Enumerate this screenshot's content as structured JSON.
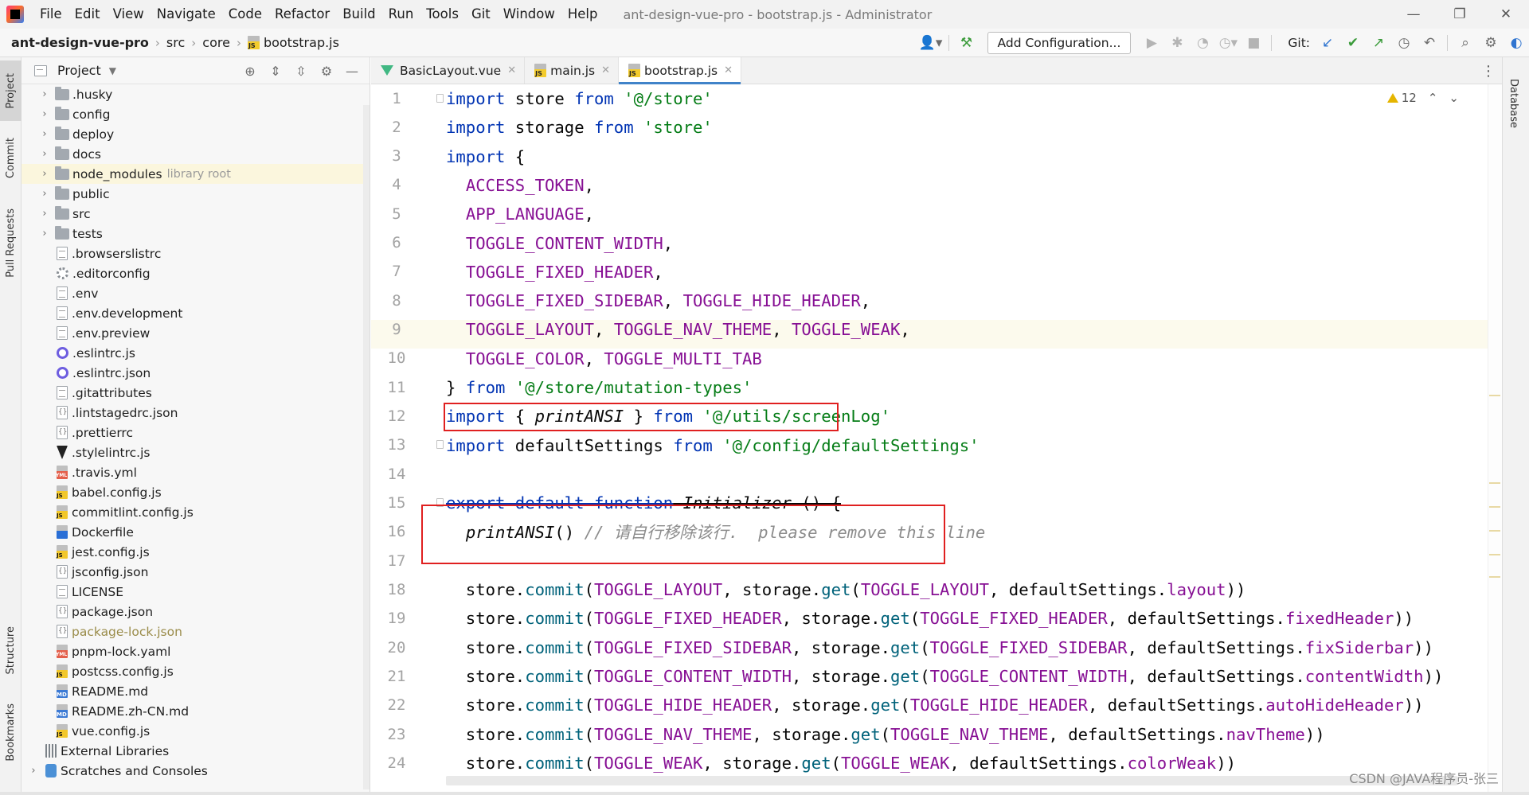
{
  "window": {
    "title": "ant-design-vue-pro - bootstrap.js - Administrator",
    "controls": [
      "—",
      "❐",
      "✕"
    ]
  },
  "menu": [
    "File",
    "Edit",
    "View",
    "Navigate",
    "Code",
    "Refactor",
    "Build",
    "Run",
    "Tools",
    "Git",
    "Window",
    "Help"
  ],
  "breadcrumb": {
    "project": "ant-design-vue-pro",
    "folder1": "src",
    "folder2": "core",
    "file": "bootstrap.js"
  },
  "toolbar": {
    "add_configuration": "Add Configuration...",
    "git_label": "Git:"
  },
  "left_strip": {
    "project": "Project",
    "commit": "Commit",
    "pull_requests": "Pull Requests",
    "structure": "Structure",
    "bookmarks": "Bookmarks"
  },
  "right_strip": {
    "database": "Database"
  },
  "project_panel": {
    "title": "Project",
    "items": [
      {
        "name": ".husky",
        "type": "folder"
      },
      {
        "name": "config",
        "type": "folder"
      },
      {
        "name": "deploy",
        "type": "folder"
      },
      {
        "name": "docs",
        "type": "folder"
      },
      {
        "name": "node_modules",
        "type": "folder",
        "note": "library root"
      },
      {
        "name": "public",
        "type": "folder"
      },
      {
        "name": "src",
        "type": "folder"
      },
      {
        "name": "tests",
        "type": "folder"
      },
      {
        "name": ".browserslistrc",
        "type": "generic"
      },
      {
        "name": ".editorconfig",
        "type": "gear"
      },
      {
        "name": ".env",
        "type": "generic"
      },
      {
        "name": ".env.development",
        "type": "generic"
      },
      {
        "name": ".env.preview",
        "type": "generic"
      },
      {
        "name": ".eslintrc.js",
        "type": "eslint"
      },
      {
        "name": ".eslintrc.json",
        "type": "eslint"
      },
      {
        "name": ".gitattributes",
        "type": "generic"
      },
      {
        "name": ".lintstagedrc.json",
        "type": "json"
      },
      {
        "name": ".prettierrc",
        "type": "json"
      },
      {
        "name": ".stylelintrc.js",
        "type": "stylelint"
      },
      {
        "name": ".travis.yml",
        "type": "yml"
      },
      {
        "name": "babel.config.js",
        "type": "js"
      },
      {
        "name": "commitlint.config.js",
        "type": "js"
      },
      {
        "name": "Dockerfile",
        "type": "docker"
      },
      {
        "name": "jest.config.js",
        "type": "js"
      },
      {
        "name": "jsconfig.json",
        "type": "json"
      },
      {
        "name": "LICENSE",
        "type": "generic"
      },
      {
        "name": "package.json",
        "type": "json"
      },
      {
        "name": "package-lock.json",
        "type": "json"
      },
      {
        "name": "pnpm-lock.yaml",
        "type": "yml"
      },
      {
        "name": "postcss.config.js",
        "type": "js"
      },
      {
        "name": "README.md",
        "type": "md"
      },
      {
        "name": "README.zh-CN.md",
        "type": "md"
      },
      {
        "name": "vue.config.js",
        "type": "js"
      },
      {
        "name": "External Libraries",
        "type": "lib"
      },
      {
        "name": "Scratches and Consoles",
        "type": "scratch"
      }
    ]
  },
  "tabs": [
    {
      "label": "BasicLayout.vue",
      "type": "vue"
    },
    {
      "label": "main.js",
      "type": "js"
    },
    {
      "label": "bootstrap.js",
      "type": "js",
      "active": true
    }
  ],
  "editor": {
    "warnings": "12",
    "lines": [
      "1",
      "2",
      "3",
      "4",
      "5",
      "6",
      "7",
      "8",
      "9",
      "10",
      "11",
      "12",
      "13",
      "14",
      "15",
      "16",
      "17",
      "18",
      "19",
      "20",
      "21",
      "22",
      "23",
      "24"
    ]
  },
  "watermark": "CSDN @JAVA程序员-张三"
}
